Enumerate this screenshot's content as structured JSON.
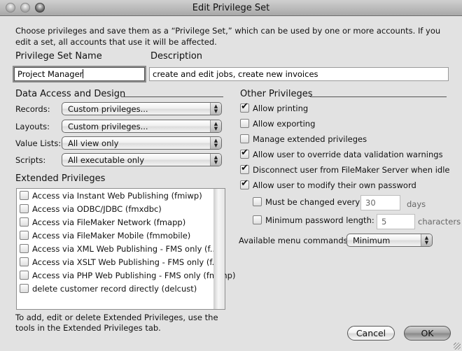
{
  "window": {
    "title": "Edit Privilege Set"
  },
  "intro": "Choose privileges and save them as a “Privilege Set,” which can be used by one or more accounts. If you edit a set, all accounts that use it will be affected.",
  "name_field": {
    "label": "Privilege Set Name",
    "value": "Project Manager"
  },
  "description_field": {
    "label": "Description",
    "value": "create and edit jobs, create new invoices"
  },
  "data_access": {
    "header": "Data Access and Design",
    "rows": [
      {
        "label": "Records:",
        "value": "Custom privileges..."
      },
      {
        "label": "Layouts:",
        "value": "Custom privileges..."
      },
      {
        "label": "Value Lists:",
        "value": "All view only"
      },
      {
        "label": "Scripts:",
        "value": "All executable only"
      }
    ]
  },
  "extended": {
    "header": "Extended Privileges",
    "items": [
      {
        "label": "Access via Instant Web Publishing (fmiwp)",
        "checked": false
      },
      {
        "label": "Access via ODBC/JDBC (fmxdbc)",
        "checked": false
      },
      {
        "label": "Access via FileMaker Network (fmapp)",
        "checked": false
      },
      {
        "label": "Access via FileMaker Mobile (fmmobile)",
        "checked": false
      },
      {
        "label": "Access via XML Web Publishing - FMS only (f...",
        "checked": false
      },
      {
        "label": "Access via XSLT Web Publishing - FMS only (f...",
        "checked": false
      },
      {
        "label": "Access via PHP Web Publishing - FMS only (fmphp)",
        "checked": false
      },
      {
        "label": "delete customer record directly (delcust)",
        "checked": false
      }
    ],
    "note": "To add, edit or delete Extended Privileges, use the tools in the Extended Privileges tab."
  },
  "other": {
    "header": "Other Privileges",
    "items": [
      {
        "label": "Allow printing",
        "checked": true
      },
      {
        "label": "Allow exporting",
        "checked": false
      },
      {
        "label": "Manage extended privileges",
        "checked": false
      },
      {
        "label": "Allow user to override data validation warnings",
        "checked": true
      },
      {
        "label": "Disconnect user from FileMaker Server when idle",
        "checked": true
      },
      {
        "label": "Allow user to modify their own password",
        "checked": true
      }
    ],
    "must_change": {
      "label": "Must be changed every",
      "value": "30",
      "unit": "days",
      "checked": false
    },
    "min_length": {
      "label": "Minimum password length:",
      "value": "5",
      "unit": "characters",
      "checked": false
    },
    "menu_commands": {
      "label": "Available menu commands:",
      "value": "Minimum"
    }
  },
  "buttons": {
    "cancel": "Cancel",
    "ok": "OK"
  }
}
